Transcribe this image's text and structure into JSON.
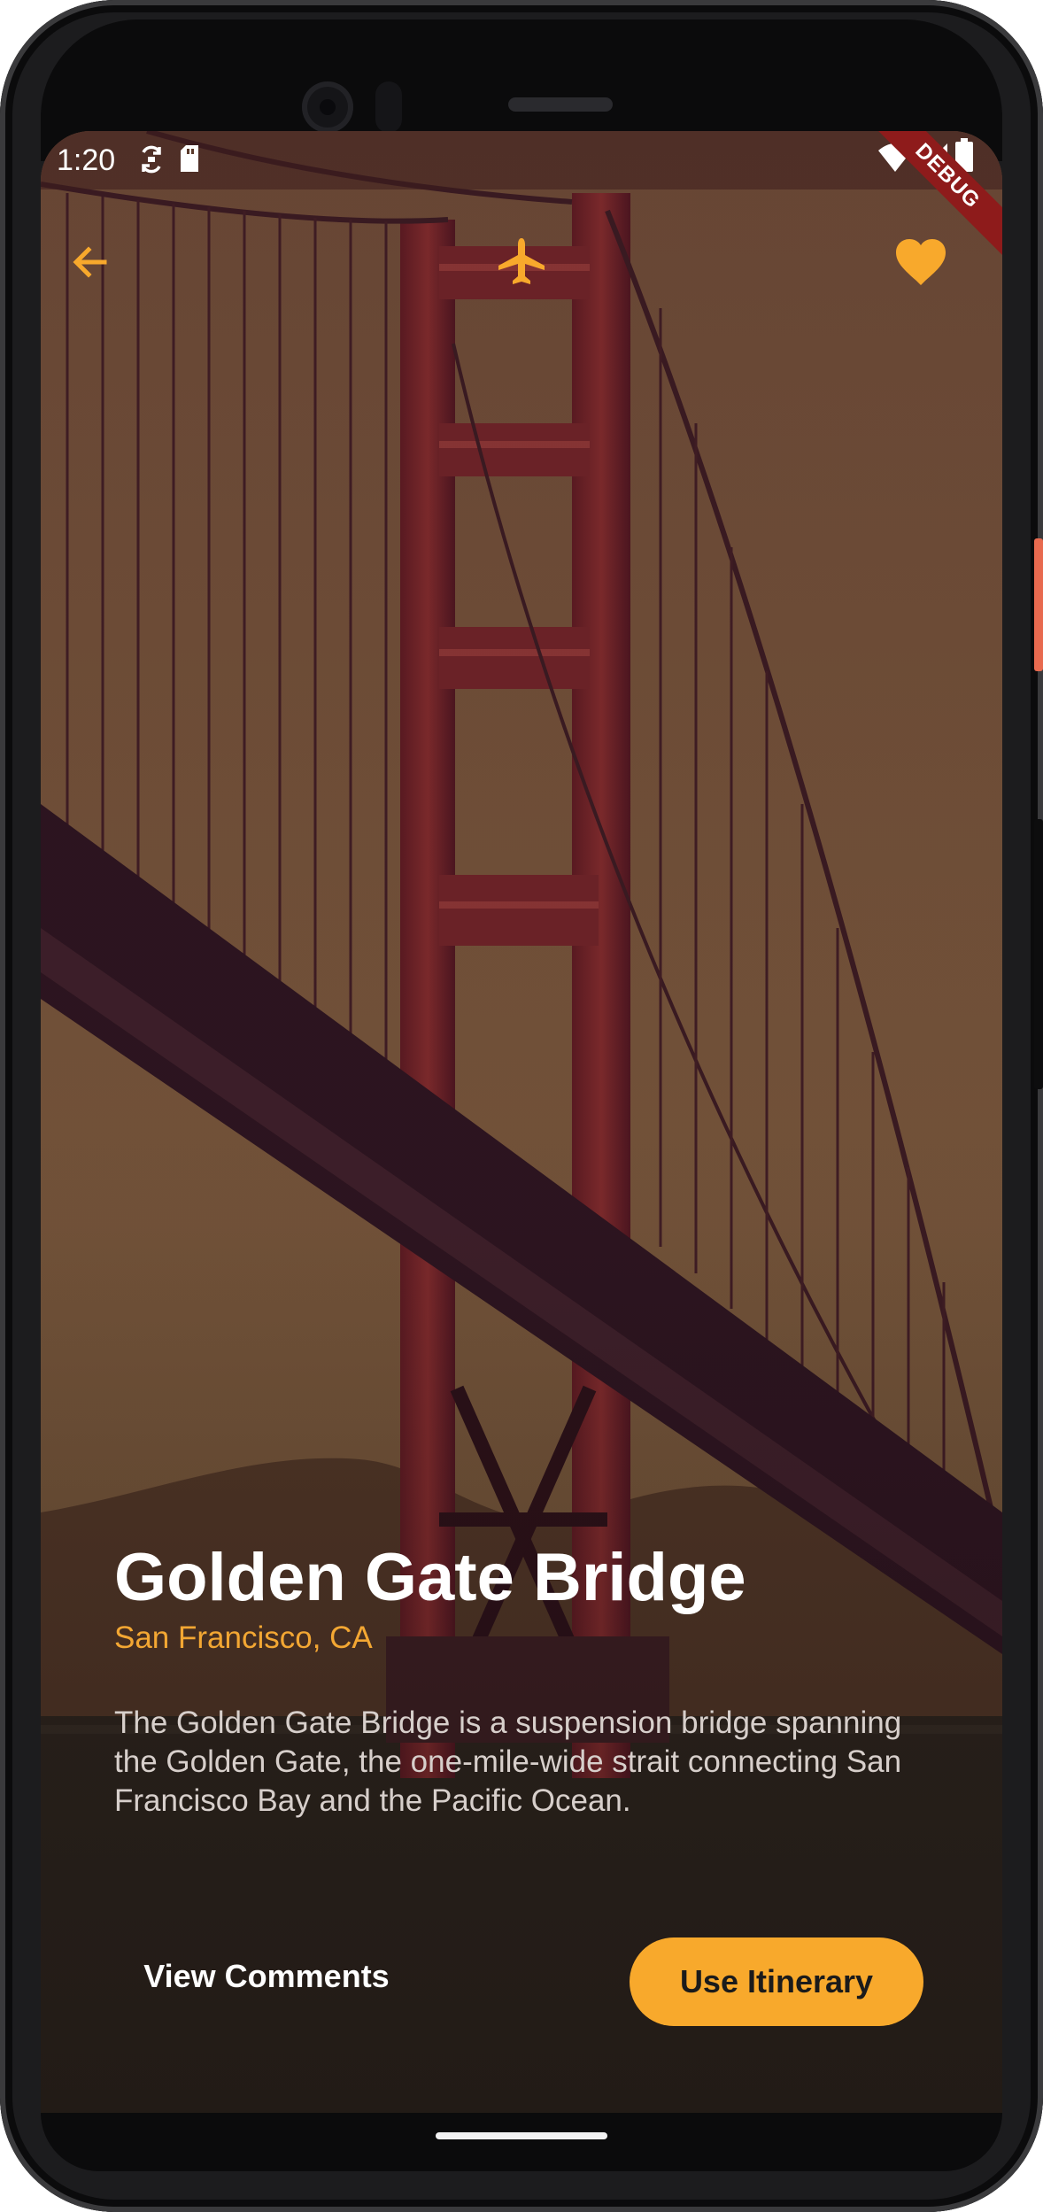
{
  "status_bar": {
    "time": "1:20",
    "icons": [
      "sync-icon",
      "sd-card-icon",
      "wifi-icon",
      "signal-icon",
      "battery-icon"
    ]
  },
  "debug_banner": "DEBUG",
  "appbar": {
    "back_icon": "arrow-back-icon",
    "center_icon": "airplane-icon",
    "favorite_icon": "heart-icon"
  },
  "colors": {
    "accent": "#f8a92c",
    "title": "#ffffff",
    "description": "#d7cfcb"
  },
  "destination": {
    "title": "Golden Gate Bridge",
    "location": "San Francisco, CA",
    "description": "The Golden Gate Bridge is a suspension bridge spanning the Golden Gate, the one-mile-wide strait connecting San Francisco Bay and the Pacific Ocean."
  },
  "actions": {
    "view_comments": "View Comments",
    "use_itinerary": "Use Itinerary"
  }
}
